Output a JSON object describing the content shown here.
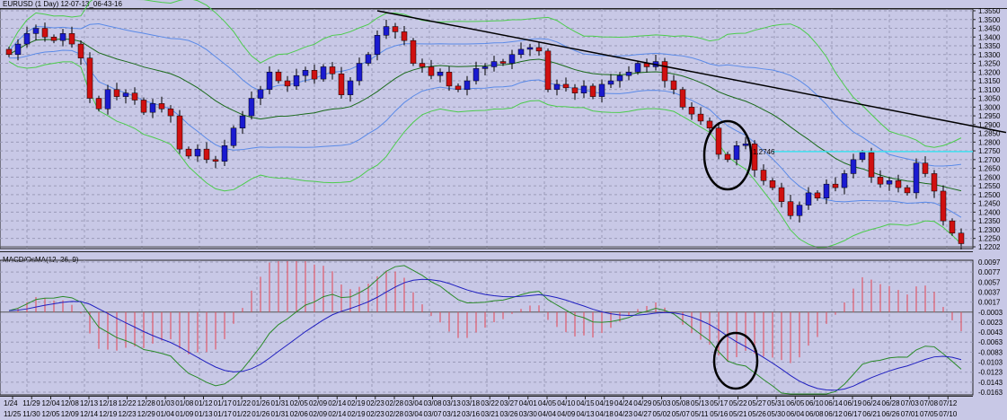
{
  "header": {
    "title": "EURUSD (1 Day) 12-07-13_06-43-16"
  },
  "indicator": {
    "title": "MACD/OsMA(12, 26, 9)"
  },
  "colors": {
    "background": "#c8c8e6",
    "bull": "#1a1ad0",
    "bear": "#d01010",
    "band_outer": "#4ccc4c",
    "band_mid": "#1a6a1a",
    "band_inner": "#5a8ae8",
    "macd": "#2020c0",
    "signal": "#2a8a2a",
    "hist": "#e05a6a",
    "cyan": "#40e0f0"
  },
  "chart_data": [
    {
      "type": "candlestick",
      "title": "EURUSD (1 Day)",
      "ylim": [
        1.2202,
        1.355
      ],
      "y_ticks": [
        "1.3550",
        "1.3500",
        "1.3450",
        "1.3400",
        "1.3350",
        "1.3300",
        "1.3250",
        "1.3200",
        "1.3150",
        "1.3100",
        "1.3050",
        "1.3000",
        "1.2950",
        "1.2900",
        "1.2850",
        "1.2800",
        "1.2750",
        "1.2700",
        "1.2650",
        "1.2600",
        "1.2550",
        "1.2500",
        "1.2450",
        "1.2400",
        "1.2350",
        "1.2300",
        "1.2250",
        "1.2202"
      ],
      "closes": [
        1.33,
        1.336,
        1.342,
        1.345,
        1.34,
        1.338,
        1.342,
        1.336,
        1.328,
        1.305,
        1.299,
        1.31,
        1.306,
        1.308,
        1.304,
        1.297,
        1.302,
        1.299,
        1.295,
        1.276,
        1.272,
        1.276,
        1.27,
        1.269,
        1.278,
        1.288,
        1.295,
        1.305,
        1.31,
        1.32,
        1.315,
        1.312,
        1.318,
        1.321,
        1.316,
        1.323,
        1.319,
        1.307,
        1.315,
        1.325,
        1.33,
        1.341,
        1.346,
        1.343,
        1.338,
        1.325,
        1.323,
        1.318,
        1.32,
        1.312,
        1.31,
        1.315,
        1.322,
        1.323,
        1.326,
        1.325,
        1.33,
        1.333,
        1.334,
        1.332,
        1.31,
        1.313,
        1.311,
        1.308,
        1.312,
        1.306,
        1.313,
        1.315,
        1.318,
        1.32,
        1.325,
        1.323,
        1.326,
        1.315,
        1.31,
        1.3,
        1.296,
        1.292,
        1.288,
        1.273,
        1.27,
        1.278,
        1.279,
        1.264,
        1.258,
        1.254,
        1.246,
        1.238,
        1.244,
        1.251,
        1.248,
        1.256,
        1.254,
        1.262,
        1.27,
        1.274,
        1.26,
        1.256,
        1.258,
        1.254,
        1.251,
        1.268,
        1.262,
        1.252,
        1.235,
        1.228,
        1.222
      ],
      "price_label": "1.2746",
      "horizontal_line": 1.2746,
      "trendline": {
        "from": {
          "candle": 41,
          "price": 1.355
        },
        "to": {
          "candle": 111,
          "price": 1.2855
        }
      },
      "x_labels_top": [
        "1/24",
        "11/29",
        "12/04",
        "12/08",
        "12/13",
        "12/18",
        "12/22",
        "12/28",
        "01/03",
        "01/08",
        "01/12",
        "01/17",
        "01/22",
        "01/26",
        "01/31",
        "02/05",
        "02/09",
        "02/14",
        "02/19",
        "02/23",
        "02/28",
        "03/04",
        "03/08",
        "03/13",
        "03/18",
        "03/22",
        "03/27",
        "04/01",
        "04/05",
        "04/10",
        "04/15",
        "04/19",
        "04/24",
        "04/29",
        "05/03",
        "05/08",
        "05/13",
        "05/17",
        "05/22",
        "05/27",
        "05/31",
        "06/05",
        "06/10",
        "06/14",
        "06/19",
        "06/24",
        "06/28",
        "07/03",
        "07/08",
        "07/12"
      ],
      "x_labels_bottom": [
        "11/25",
        "11/30",
        "12/05",
        "12/09",
        "12/14",
        "12/19",
        "12/23",
        "12/29",
        "01/04",
        "01/09",
        "01/13",
        "01/17",
        "01/22",
        "01/26",
        "01/31",
        "02/06",
        "02/09",
        "02/14",
        "02/19",
        "02/23",
        "02/28",
        "03/04",
        "03/07",
        "03/12",
        "03/16",
        "03/21",
        "03/26",
        "03/30",
        "04/04",
        "04/09",
        "04/13",
        "04/18",
        "04/23",
        "04/27",
        "05/02",
        "05/07",
        "05/11",
        "05/16",
        "05/21",
        "05/26",
        "05/30",
        "06/04",
        "06/08",
        "06/12",
        "06/17",
        "06/21",
        "06/26",
        "07/01",
        "07/05",
        "07/10"
      ]
    },
    {
      "type": "line",
      "title": "MACD/OsMA(12, 26, 9)",
      "ylim": [
        -0.0163,
        0.0097
      ],
      "y_ticks": [
        "0.0097",
        "0.0077",
        "0.0057",
        "0.0037",
        "0.0017",
        "-0.0003",
        "-0.0023",
        "-0.0043",
        "-0.0063",
        "-0.0083",
        "-0.0103",
        "-0.0123",
        "-0.0143",
        "-0.0163"
      ],
      "params": [
        12,
        26,
        9
      ]
    }
  ]
}
